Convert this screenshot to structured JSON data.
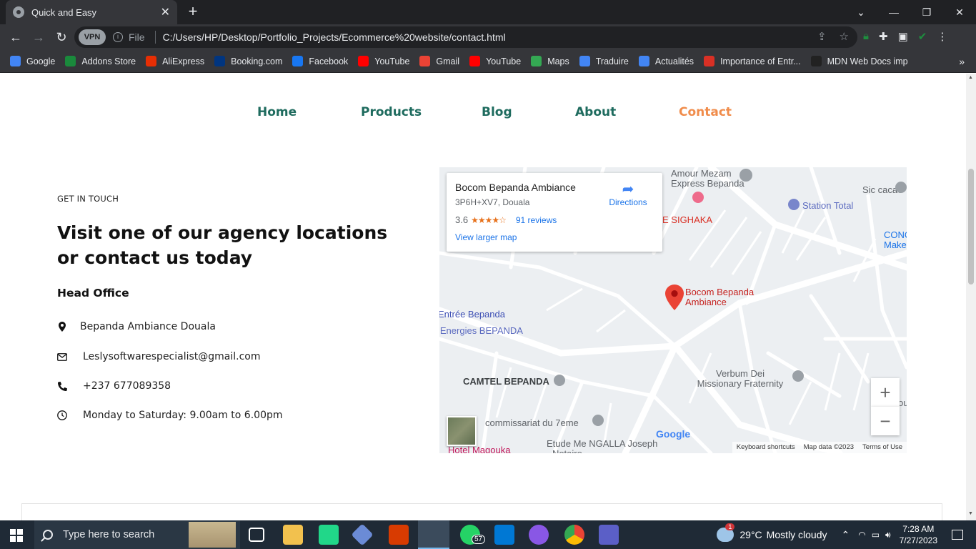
{
  "browser": {
    "tab_title": "Quick and Easy",
    "tab_close": "✕",
    "new_tab": "+",
    "vpn_label": "VPN",
    "file_label": "File",
    "url": "C:/Users/HP/Desktop/Portfolio_Projects/Ecommerce%20website/contact.html",
    "bookmarks": [
      "Google",
      "Addons Store",
      "AliExpress",
      "Booking.com",
      "Facebook",
      "YouTube",
      "Gmail",
      "YouTube",
      "Maps",
      "Traduire",
      "Actualités",
      "Importance of Entr...",
      "MDN Web Docs imp"
    ],
    "bookmark_colors": [
      "#4285f4",
      "#1a8a3c",
      "#e62e04",
      "#003580",
      "#1877f2",
      "#ff0000",
      "#ea4335",
      "#ff0000",
      "#34a853",
      "#4285f4",
      "#4285f4",
      "#d93025",
      "#222222"
    ]
  },
  "site": {
    "nav": [
      "Home",
      "Products",
      "Blog",
      "About",
      "Contact"
    ],
    "active_nav": "Contact",
    "accent_color": "#f08c4b",
    "nav_color": "#1e6b5e",
    "eyebrow": "GET IN TOUCH",
    "heading": "Visit one of our agency locations or contact us today",
    "subhead": "Head Office",
    "address": "Bepanda Ambiance Douala",
    "email": "Leslysoftwarespecialist@gmail.com",
    "phone": "+237 677089358",
    "hours": "Monday to Saturday: 9.00am to 6.00pm"
  },
  "map": {
    "place_name": "Bocom Bepanda Ambiance",
    "plus_code": "3P6H+XV7, Douala",
    "rating": "3.6",
    "stars": "★★★★☆",
    "reviews": "91 reviews",
    "larger_map": "View larger map",
    "directions": "Directions",
    "labels": [
      "Amour Mezam Express Bepanda",
      "Sic cacao",
      "Station Total",
      "CONC Make",
      "E SIGHAKA",
      "Bocom Bepanda Ambiance",
      "Entrée Bepanda",
      "lEnergies BEPANDA",
      "CAMTEL BEPANDA",
      "Verbum Dei Missionary Fraternity",
      "commissariat du 7eme",
      "Etude Me NGALLA Joseph - Notaire",
      "Hotel Magouka",
      "ou"
    ],
    "zoom_in": "+",
    "zoom_out": "−",
    "google": "Google",
    "footer": [
      "Keyboard shortcuts",
      "Map data ©2023",
      "Terms of Use"
    ]
  },
  "taskbar": {
    "search_placeholder": "Type here to search",
    "whatsapp_badge": "57",
    "weather_temp": "29°C",
    "weather_desc": "Mostly cloudy",
    "weather_badge": "1",
    "time": "7:28 AM",
    "date": "7/27/2023"
  }
}
